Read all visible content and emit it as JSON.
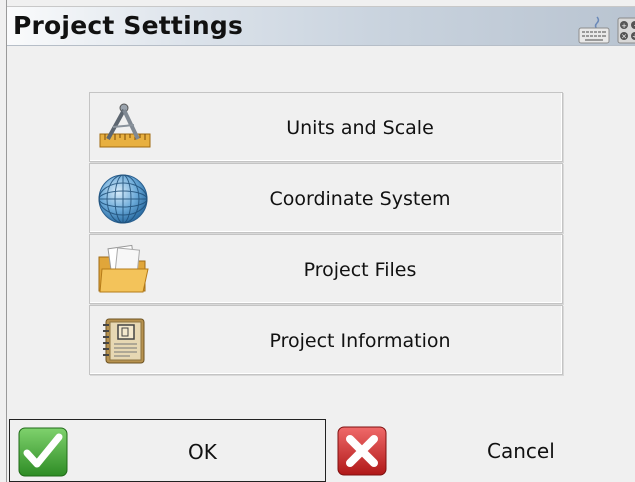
{
  "window": {
    "title": "Project Settings",
    "title_bar_icons": [
      "keyboard-icon",
      "calculator-icon"
    ]
  },
  "menu": {
    "items": [
      {
        "label": "Units and Scale",
        "icon": "compass-ruler-icon"
      },
      {
        "label": "Coordinate System",
        "icon": "globe-icon"
      },
      {
        "label": "Project Files",
        "icon": "folder-icon"
      },
      {
        "label": "Project Information",
        "icon": "notebook-icon"
      }
    ]
  },
  "footer": {
    "ok_label": "OK",
    "ok_icon": "checkmark-icon",
    "cancel_label": "Cancel",
    "cancel_icon": "x-icon"
  },
  "colors": {
    "background": "#f0f0f0",
    "ok_green": "#3fa535",
    "cancel_red": "#d42a2a"
  }
}
